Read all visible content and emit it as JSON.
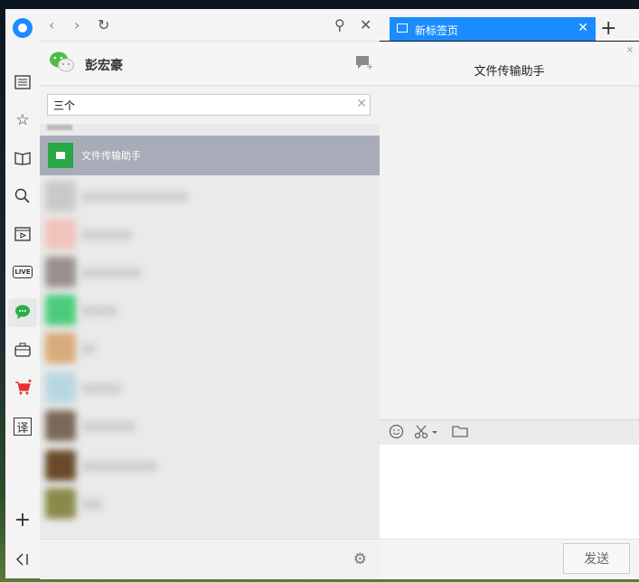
{
  "rail": {
    "icons": [
      "browser-logo-icon",
      "news-icon",
      "star-icon",
      "book-icon",
      "search-icon",
      "video-icon",
      "live-icon",
      "wechat-icon",
      "briefcase-icon",
      "cart-icon",
      "translate-icon",
      "plus-icon",
      "collapse-icon"
    ],
    "live_label": "LIVE",
    "translate_label": "译"
  },
  "toolbar": {
    "back": "‹",
    "forward": "›",
    "refresh": "↻",
    "pin": "⚲",
    "close": "✕"
  },
  "tab": {
    "title": "新标签页",
    "close": "✕",
    "new_tab": "+"
  },
  "wechat": {
    "username": "彭宏豪",
    "search_value": "三个",
    "search_clear": "✕",
    "selected_contact": "文件传输助手"
  },
  "chat": {
    "title": "文件传输助手",
    "close_x": "×",
    "send_label": "发送",
    "tools": [
      "emoji-icon",
      "scissors-icon",
      "folder-icon"
    ]
  },
  "colors": {
    "accent": "#1a8cff",
    "selected_row": "#a8acb9",
    "wechat_green": "#28a745"
  }
}
